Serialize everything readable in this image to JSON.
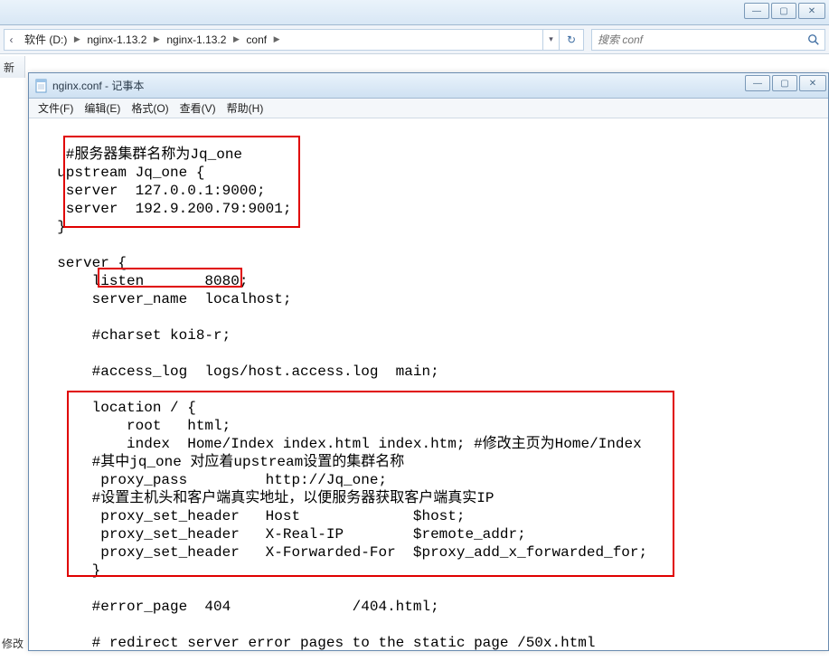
{
  "parent_window": {
    "min": "—",
    "max": "▢",
    "close": "✕"
  },
  "breadcrumb": {
    "items": [
      "软件 (D:)",
      "nginx-1.13.2",
      "nginx-1.13.2",
      "conf"
    ]
  },
  "search": {
    "placeholder": "搜索 conf"
  },
  "left_labels": {
    "top": "新",
    "bottom": "修改"
  },
  "notepad": {
    "title": "nginx.conf - 记事本",
    "menu": {
      "file": "文件(F)",
      "edit": "编辑(E)",
      "format": "格式(O)",
      "view": "查看(V)",
      "help": "帮助(H)"
    },
    "min": "—",
    "max": "▢",
    "close": "✕",
    "content": "\n   #服务器集群名称为Jq_one\n  upstream Jq_one {\n   server  127.0.0.1:9000;\n   server  192.9.200.79:9001;\n  }\n\n  server {\n      listen       8080;\n      server_name  localhost;\n\n      #charset koi8-r;\n\n      #access_log  logs/host.access.log  main;\n\n      location / {\n          root   html;\n          index  Home/Index index.html index.htm; #修改主页为Home/Index\n      #其中jq_one 对应着upstream设置的集群名称\n       proxy_pass         http://Jq_one;\n      #设置主机头和客户端真实地址，以便服务器获取客户端真实IP\n       proxy_set_header   Host             $host;\n       proxy_set_header   X-Real-IP        $remote_addr;\n       proxy_set_header   X-Forwarded-For  $proxy_add_x_forwarded_for;\n      }\n\n      #error_page  404              /404.html;\n\n      # redirect server error pages to the static page /50x.html"
  }
}
